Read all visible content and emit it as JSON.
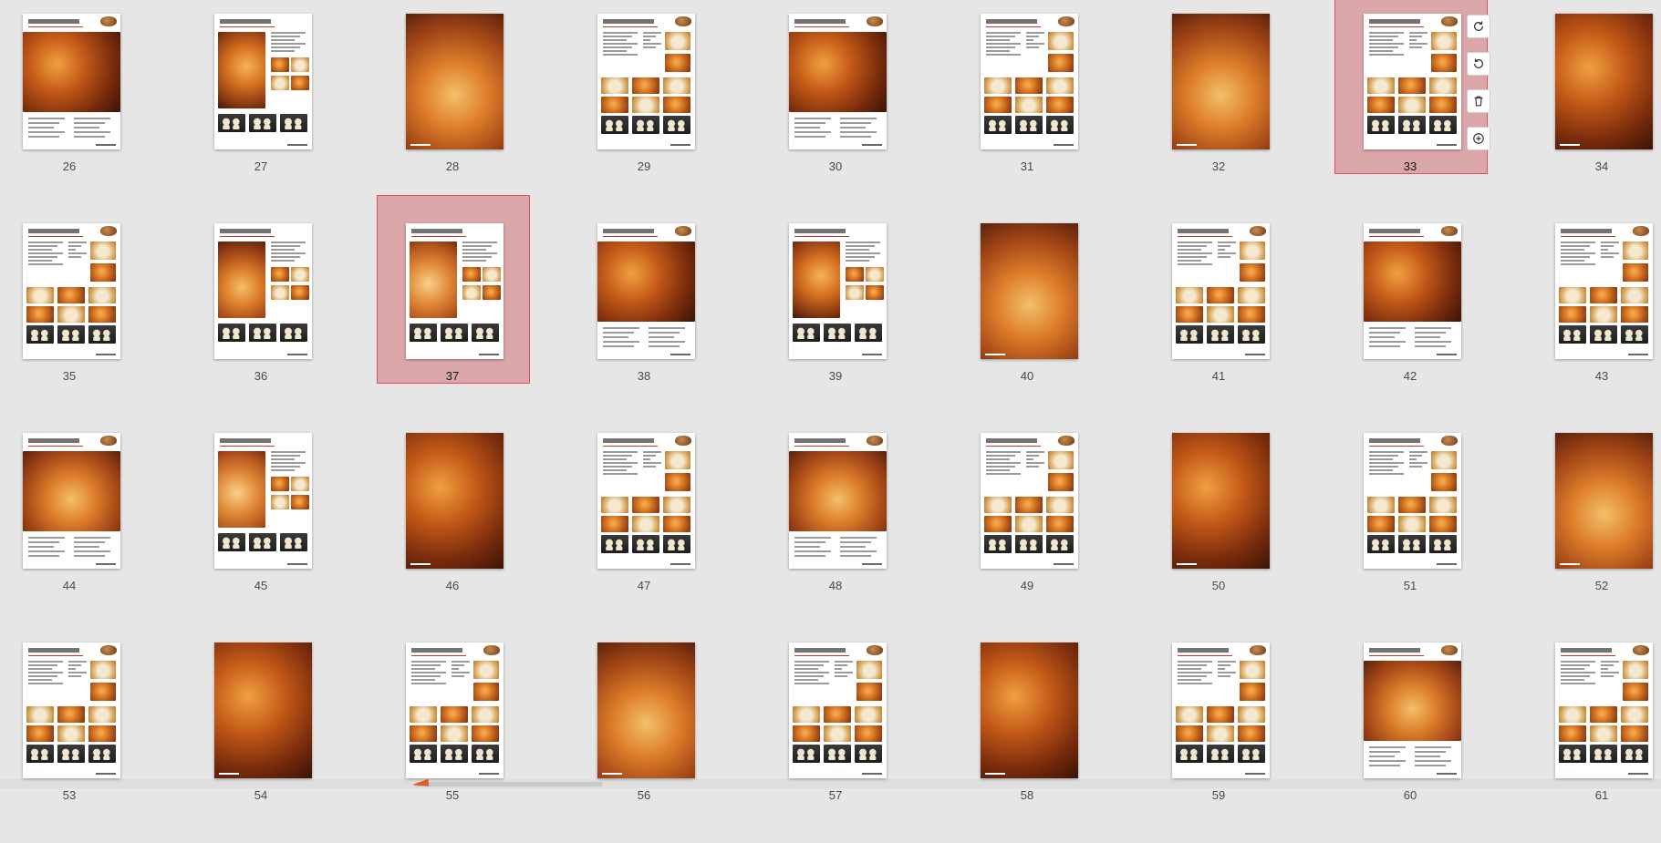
{
  "app": {
    "view": "page-thumbnails"
  },
  "selected_pages": [
    33,
    37
  ],
  "colors": {
    "selection_fill": "#dca7a9",
    "selection_border": "#e0505a",
    "background": "#e6e6e6",
    "scroll_arrow": "#e05a2a"
  },
  "toolbar": {
    "buttons": [
      {
        "icon": "rotate-clockwise-icon"
      },
      {
        "icon": "rotate-counterclockwise-icon"
      },
      {
        "icon": "delete-icon"
      },
      {
        "icon": "insert-page-icon"
      }
    ]
  },
  "pages": [
    {
      "number": "26",
      "type": "photo-top-text",
      "title": "全麦蕃茄面包"
    },
    {
      "number": "27",
      "type": "recipe-side-photo"
    },
    {
      "number": "28",
      "type": "photo"
    },
    {
      "number": "29",
      "type": "recipe-grid",
      "title": "全麦核桃面包"
    },
    {
      "number": "30",
      "type": "photo-top-text",
      "title": "硬式面包"
    },
    {
      "number": "31",
      "type": "recipe-grid",
      "title": "法国棒"
    },
    {
      "number": "32",
      "type": "photo"
    },
    {
      "number": "33",
      "type": "recipe-grid",
      "title": "法国乳酪面包"
    },
    {
      "number": "34",
      "type": "photo"
    },
    {
      "number": "35",
      "type": "recipe-grid",
      "title": "法国长条面包"
    },
    {
      "number": "36",
      "type": "recipe-side-photo",
      "title": "杂粮面包"
    },
    {
      "number": "37",
      "type": "recipe-side-photo",
      "title": "全麦黑麦面包"
    },
    {
      "number": "38",
      "type": "photo-top-text",
      "title": "菠萝奶酥面包"
    },
    {
      "number": "39",
      "type": "recipe-side-photo",
      "title": "菠萝流沙面包"
    },
    {
      "number": "40",
      "type": "photo"
    },
    {
      "number": "41",
      "type": "recipe-grid",
      "title": "菠萝奶香面包"
    },
    {
      "number": "42",
      "type": "photo-top-text",
      "title": "甜面包"
    },
    {
      "number": "43",
      "type": "recipe-grid",
      "title": "卡士达面包"
    },
    {
      "number": "44",
      "type": "photo-top-text",
      "title": "奶油卷"
    },
    {
      "number": "45",
      "type": "recipe-side-photo",
      "title": "红豆面包"
    },
    {
      "number": "46",
      "type": "photo"
    },
    {
      "number": "47",
      "type": "recipe-grid",
      "title": "红豆卷面包"
    },
    {
      "number": "48",
      "type": "photo-top-text"
    },
    {
      "number": "49",
      "type": "recipe-grid",
      "title": "菠萝面包"
    },
    {
      "number": "50",
      "type": "photo"
    },
    {
      "number": "51",
      "type": "recipe-grid",
      "title": "菠萝夹心面包"
    },
    {
      "number": "52",
      "type": "photo"
    },
    {
      "number": "53",
      "type": "recipe-grid",
      "title": "墨西哥面包"
    },
    {
      "number": "54",
      "type": "photo"
    },
    {
      "number": "55",
      "type": "recipe-grid",
      "title": "奶酥面包"
    },
    {
      "number": "56",
      "type": "photo"
    },
    {
      "number": "57",
      "type": "recipe-grid",
      "title": "葡萄面包"
    },
    {
      "number": "58",
      "type": "photo"
    },
    {
      "number": "59",
      "type": "recipe-grid",
      "title": "克林姆面包"
    },
    {
      "number": "60",
      "type": "photo-top-text",
      "title": "甜甜圈"
    },
    {
      "number": "61",
      "type": "recipe-grid"
    }
  ]
}
